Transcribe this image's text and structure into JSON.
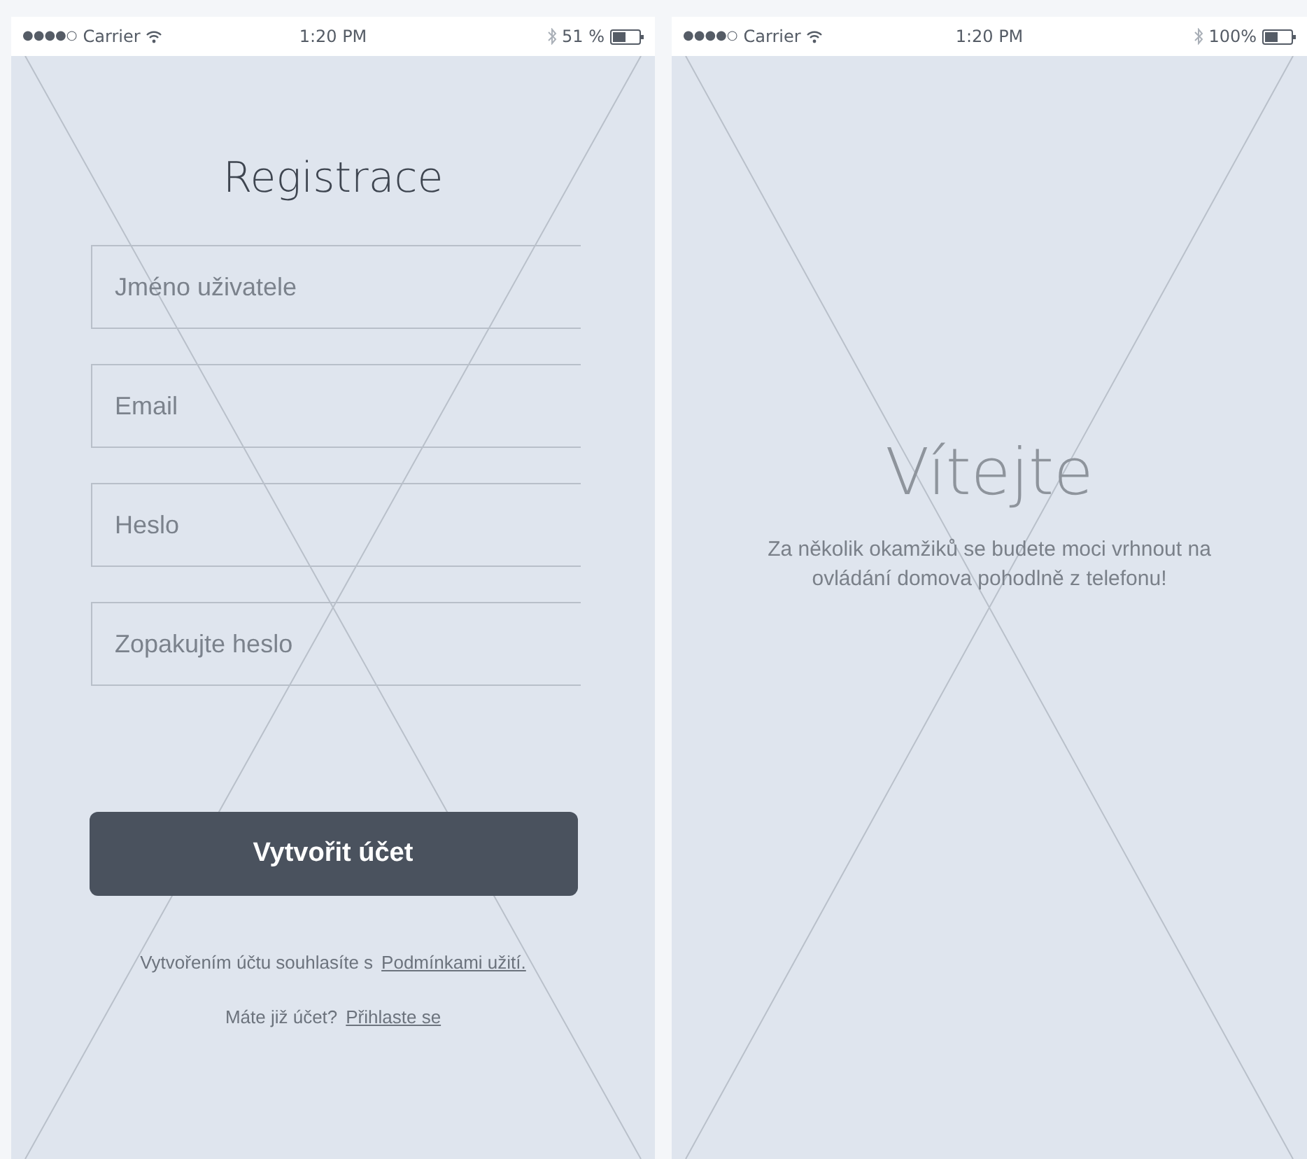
{
  "screens": [
    {
      "kind": "register",
      "status_bar": {
        "signal": "●●●●○",
        "carrier": "Carrier",
        "time": "1:20 PM",
        "battery": "51 %"
      },
      "title": "Registrace",
      "fields": [
        {
          "placeholder": "Jméno uživatele"
        },
        {
          "placeholder": "Email"
        },
        {
          "placeholder": "Heslo"
        },
        {
          "placeholder": "Zopakujte heslo"
        }
      ],
      "button": "Vytvořit účet",
      "terms": {
        "text": "Vytvořením účtu souhlasíte s",
        "link": "Podmínkami užití."
      },
      "login": {
        "text": "Máte již účet?",
        "link": "Přihlaste se"
      }
    },
    {
      "kind": "welcome",
      "status_bar": {
        "signal": "●●●●○",
        "carrier": "Carrier",
        "time": "1:20 PM",
        "battery": "100%"
      },
      "title": "Vítejte",
      "message": "Za několik okamžiků se budete moci vrhnout na ovládání domova pohodlně z telefonu!"
    }
  ]
}
